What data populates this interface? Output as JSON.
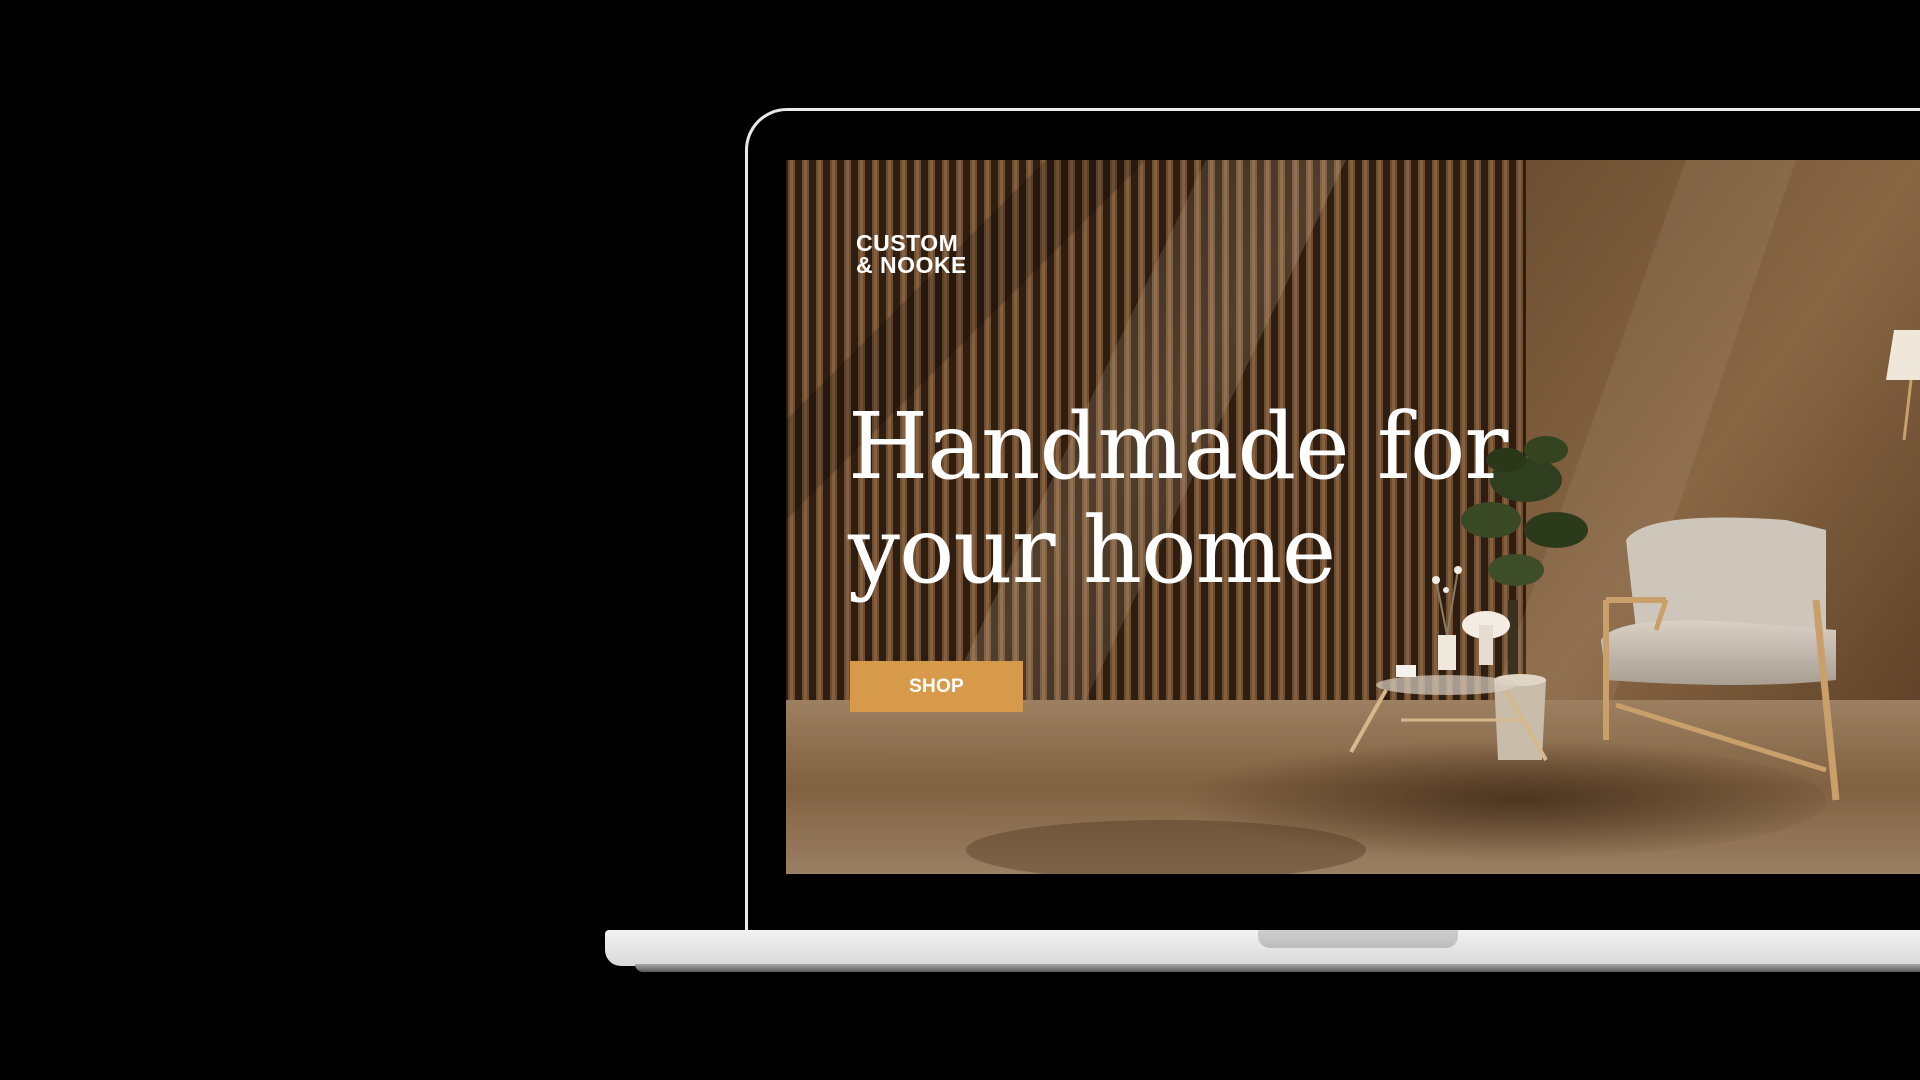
{
  "site": {
    "logo_line1": "CUSTOM",
    "logo_line2": "& NOOKE"
  },
  "hero": {
    "headline_line1": "Handmade for",
    "headline_line2": "your home",
    "cta_label": "SHOP"
  },
  "colors": {
    "page_background": "#000000",
    "laptop_frame": "#e9e9e9",
    "cta_background": "#d79a4a",
    "text": "#ffffff"
  }
}
